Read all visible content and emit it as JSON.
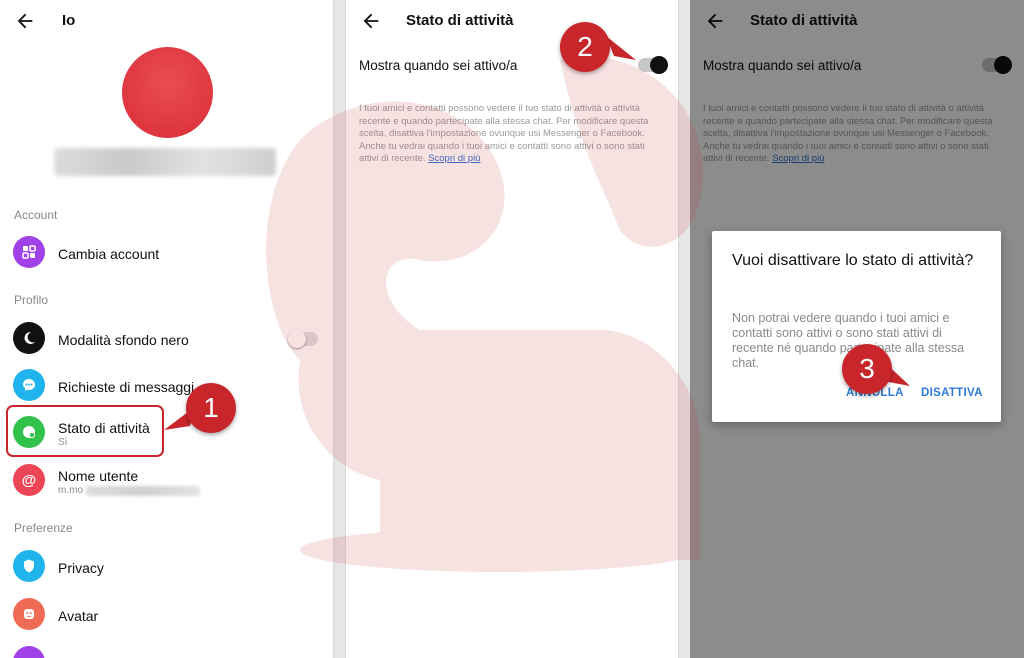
{
  "panel1": {
    "title": "Io",
    "sections": {
      "account": "Account",
      "profile": "Profilo",
      "preferences": "Preferenze"
    },
    "items": [
      {
        "label": "Cambia account",
        "icon": "switch-account-icon",
        "color": "#a042e8"
      },
      {
        "label": "Modalità sfondo nero",
        "icon": "moon-icon",
        "color": "#111111"
      },
      {
        "label": "Richieste di messaggi",
        "icon": "message-request-icon",
        "color": "#1fb4ec"
      },
      {
        "label": "Stato di attività",
        "sub": "Sì",
        "icon": "activity-status-icon",
        "color": "#31c24a"
      },
      {
        "label": "Nome utente",
        "sub": "m.mo",
        "icon": "at-sign-icon",
        "color": "#ec4656"
      },
      {
        "label": "Privacy",
        "icon": "shield-icon",
        "color": "#1fb4ec"
      },
      {
        "label": "Avatar",
        "icon": "avatar-icon",
        "color": "#ef6b55"
      }
    ],
    "step": "1"
  },
  "panel2": {
    "title": "Stato di attività",
    "setting_label": "Mostra quando sei attivo/a",
    "toggle_state": "on",
    "description": "I tuoi amici e contatti possono vedere il tuo stato di attività o attività recente e quando partecipate alla stessa chat. Per modificare questa scelta, disattiva l'impostazione ovunque usi Messenger o Facebook. Anche tu vedrai quando i tuoi amici e contatti sono attivi o sono stati attivi di recente.",
    "link": "Scopri di più",
    "step": "2"
  },
  "panel3": {
    "title": "Stato di attività",
    "setting_label": "Mostra quando sei attivo/a",
    "description": "I tuoi amici e contatti possono vedere il tuo stato di attività o attività recente e quando partecipate alla stessa chat. Per modificare questa scelta, disattiva l'impostazione ovunque usi Messenger o Facebook. Anche tu vedrai quando i tuoi amici e contatti sono attivi o sono stati attivi di recente.",
    "link": "Scopri di più",
    "dialog": {
      "title": "Vuoi disattivare lo stato di attività?",
      "body": "Non potrai vedere quando i tuoi amici e contatti sono attivi o sono stati attivi di recente né quando partecipate alla stessa chat.",
      "cancel": "ANNULLA",
      "confirm": "DISATTIVA"
    },
    "step": "3"
  },
  "colors": {
    "accent_red": "#c9262c",
    "link_blue": "#2c6fd1",
    "button_blue": "#2c7ad6"
  }
}
